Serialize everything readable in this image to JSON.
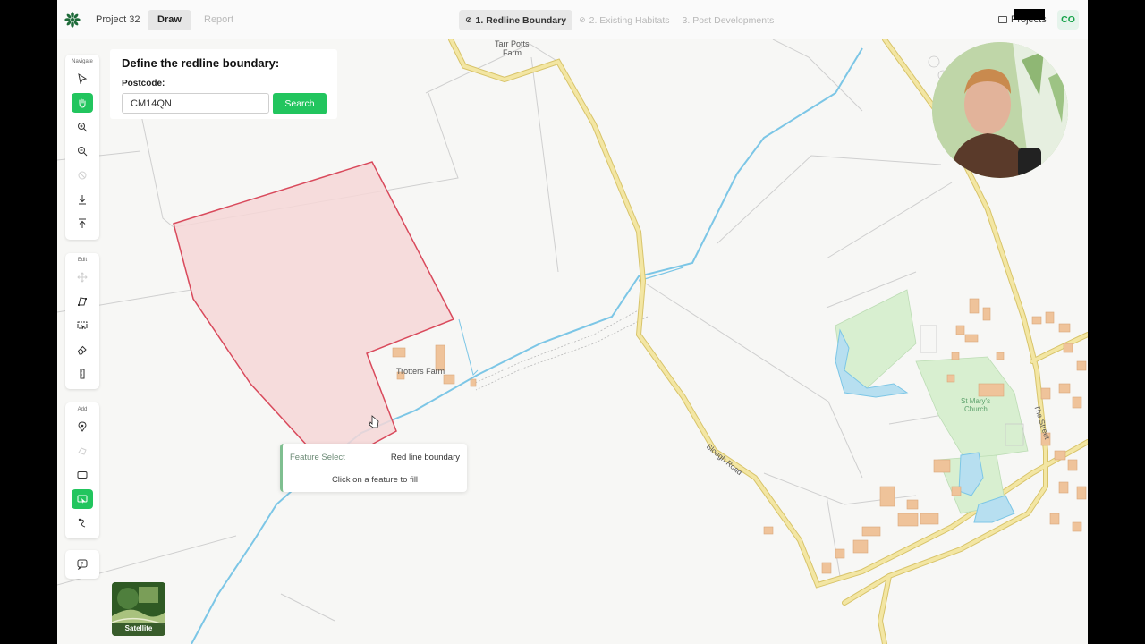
{
  "header": {
    "project_name": "Project 32",
    "tabs": [
      {
        "label": "Draw",
        "active": true
      },
      {
        "label": "Report",
        "active": false
      }
    ],
    "steps": [
      {
        "label": "1. Redline Boundary",
        "active": true
      },
      {
        "label": "2. Existing Habitats",
        "active": false
      },
      {
        "label": "3. Post Developments",
        "active": false
      }
    ],
    "projects_label": "Projects",
    "user_initials": "CO"
  },
  "toolbar": {
    "navigate_label": "Navigate",
    "edit_label": "Edit",
    "add_label": "Add",
    "navigate_tools": [
      {
        "icon": "pointer-icon",
        "state": "normal"
      },
      {
        "icon": "hand-pan-icon",
        "state": "active"
      },
      {
        "icon": "zoom-in-icon",
        "state": "normal"
      },
      {
        "icon": "zoom-out-icon",
        "state": "normal"
      },
      {
        "icon": "disabled-nav-icon",
        "state": "disabled"
      },
      {
        "icon": "download-icon",
        "state": "normal"
      },
      {
        "icon": "upload-icon",
        "state": "normal"
      }
    ],
    "edit_tools": [
      {
        "icon": "move-icon",
        "state": "disabled"
      },
      {
        "icon": "edit-vertices-icon",
        "state": "normal"
      },
      {
        "icon": "select-area-icon",
        "state": "normal"
      },
      {
        "icon": "eraser-icon",
        "state": "normal"
      },
      {
        "icon": "ruler-icon",
        "state": "normal"
      }
    ],
    "add_tools": [
      {
        "icon": "add-point-icon",
        "state": "normal"
      },
      {
        "icon": "add-disabled-icon",
        "state": "disabled"
      },
      {
        "icon": "rectangle-icon",
        "state": "normal"
      },
      {
        "icon": "feature-fill-icon",
        "state": "active"
      },
      {
        "icon": "add-line-icon",
        "state": "normal"
      }
    ],
    "help_icon": "help-icon"
  },
  "panel": {
    "title": "Define the redline boundary:",
    "postcode_label": "Postcode:",
    "postcode_value": "CM14QN",
    "search_label": "Search"
  },
  "feature_select": {
    "title": "Feature Select",
    "layer": "Red line boundary",
    "hint": "Click on a feature to fill"
  },
  "map": {
    "labels": {
      "tarr_potts": "Tarr Potts",
      "farm": "Farm",
      "trotters_farm": "Trotters Farm",
      "st_marys": "St Mary's",
      "church": "Church",
      "slough_road": "Slough Road",
      "the_street": "The Street"
    },
    "colors": {
      "boundary_stroke": "#d94a5c",
      "boundary_fill": "#f6d7d7",
      "road": "#f3e6a3",
      "water": "#7cc6e6",
      "building": "#efc39a",
      "green": "#d8efd0",
      "accent": "#22c55e"
    }
  },
  "satellite_label": "Satellite"
}
